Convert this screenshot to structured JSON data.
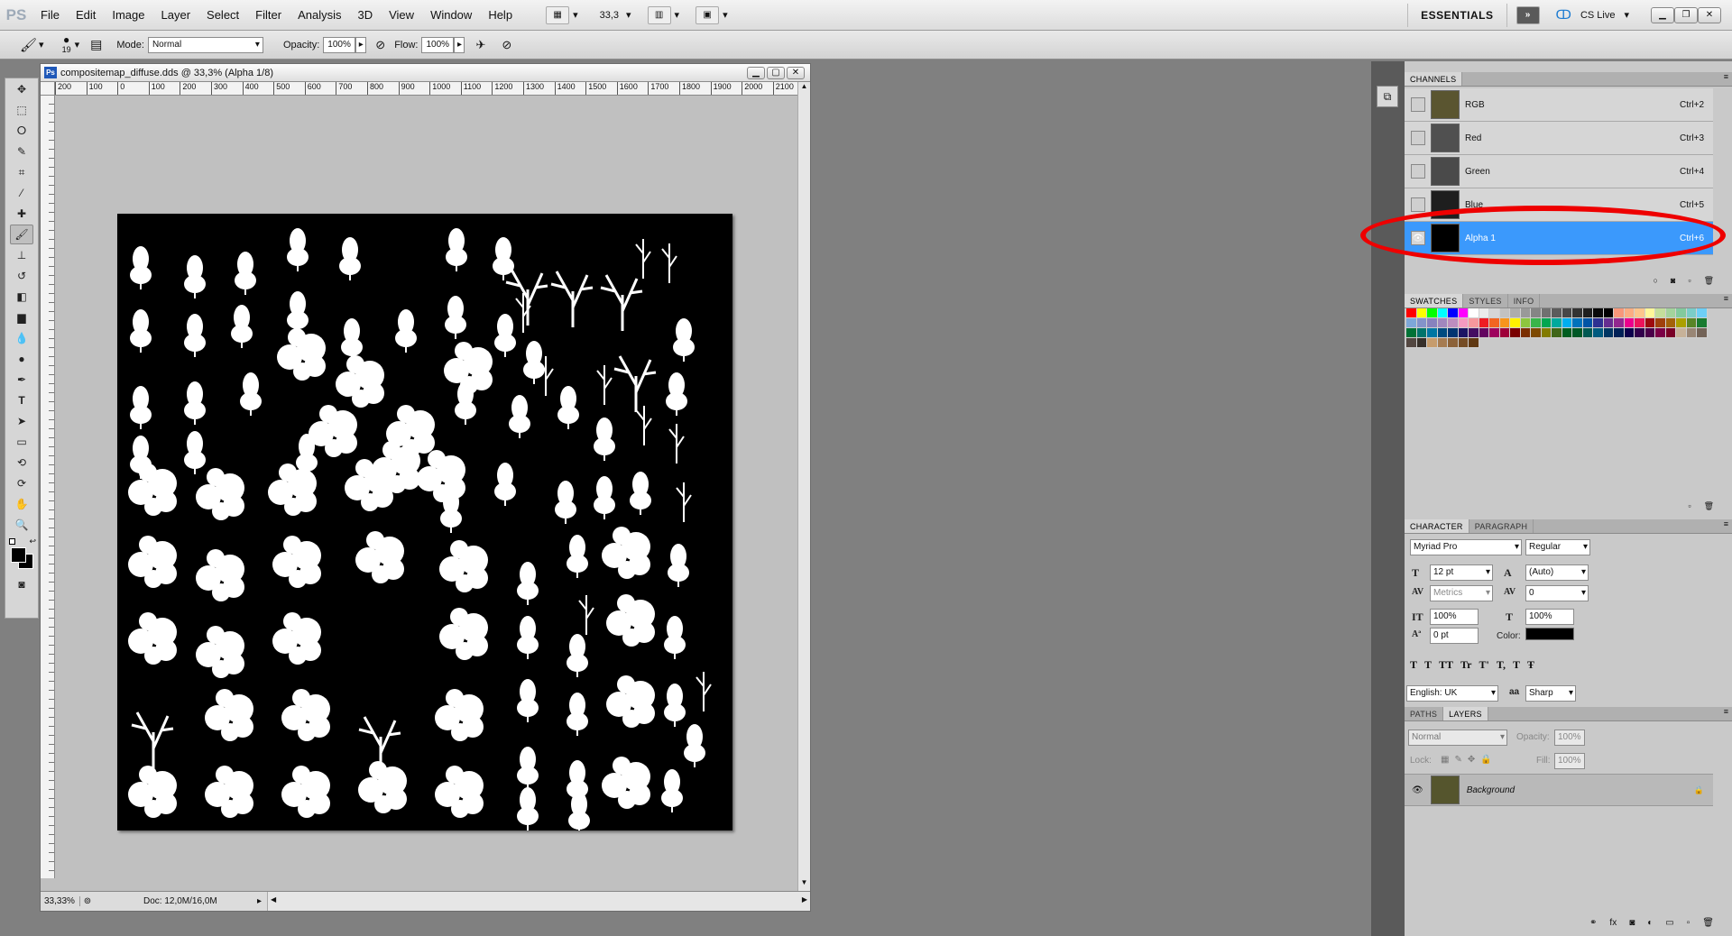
{
  "menubar": {
    "logo": "PS",
    "items": [
      "File",
      "Edit",
      "Image",
      "Layer",
      "Select",
      "Filter",
      "Analysis",
      "3D",
      "View",
      "Window",
      "Help"
    ],
    "zoom_value": "33,3",
    "workspace": "ESSENTIALS",
    "cs_live": "CS Live"
  },
  "options": {
    "brush_size": "19",
    "mode_label": "Mode:",
    "mode_value": "Normal",
    "opacity_label": "Opacity:",
    "opacity_value": "100%",
    "flow_label": "Flow:",
    "flow_value": "100%"
  },
  "document": {
    "title": "compositemap_diffuse.dds @ 33,3% (Alpha 1/8)",
    "ruler_ticks": [
      "200",
      "100",
      "0",
      "100",
      "200",
      "300",
      "400",
      "500",
      "600",
      "700",
      "800",
      "900",
      "1000",
      "1100",
      "1200",
      "1300",
      "1400",
      "1500",
      "1600",
      "1700",
      "1800",
      "1900",
      "2000",
      "2100",
      "220"
    ],
    "status_zoom": "33,33%",
    "status_doc": "Doc: 12,0M/16,0M"
  },
  "channels": {
    "tabs": [
      "CHANNELS"
    ],
    "rows": [
      {
        "name": "RGB",
        "key": "Ctrl+2",
        "thumb": "#5a5530"
      },
      {
        "name": "Red",
        "key": "Ctrl+3",
        "thumb": "#505050"
      },
      {
        "name": "Green",
        "key": "Ctrl+4",
        "thumb": "#4a4a4a"
      },
      {
        "name": "Blue",
        "key": "Ctrl+5",
        "thumb": "#1e1e1e"
      },
      {
        "name": "Alpha 1",
        "key": "Ctrl+6",
        "thumb": "#000000"
      }
    ]
  },
  "swatches": {
    "tabs": [
      "SWATCHES",
      "STYLES",
      "INFO"
    ],
    "colors": [
      "#ff0000",
      "#ffff00",
      "#00ff00",
      "#00ffff",
      "#0000ff",
      "#ff00ff",
      "#ffffff",
      "#ebebeb",
      "#d6d6d6",
      "#c2c2c2",
      "#adadad",
      "#999999",
      "#858585",
      "#707070",
      "#5c5c5c",
      "#474747",
      "#333333",
      "#1f1f1f",
      "#0a0a0a",
      "#000000",
      "#f7977a",
      "#fbad82",
      "#fdc68c",
      "#fff79a",
      "#c4df9b",
      "#a3d39c",
      "#82ca9d",
      "#7bcdc8",
      "#6ecff6",
      "#7ea7d8",
      "#8493ca",
      "#8882be",
      "#a187be",
      "#bc8dbf",
      "#f49ac1",
      "#f6989d",
      "#ed1c24",
      "#f26522",
      "#f7941d",
      "#fff200",
      "#8dc63f",
      "#39b54a",
      "#00a651",
      "#00a99d",
      "#00aeef",
      "#0072bc",
      "#0054a6",
      "#2e3192",
      "#662d91",
      "#92278f",
      "#ec008c",
      "#ed145b",
      "#9e0b0f",
      "#a0410d",
      "#a3620a",
      "#aba000",
      "#598527",
      "#197b30",
      "#007236",
      "#00746b",
      "#0076a3",
      "#004b80",
      "#003471",
      "#1b1464",
      "#440e62",
      "#630460",
      "#9e005d",
      "#9e0039",
      "#790000",
      "#7b2e00",
      "#7d4900",
      "#827b00",
      "#406618",
      "#005e20",
      "#005826",
      "#005952",
      "#005b7f",
      "#003663",
      "#002157",
      "#0d004c",
      "#32004b",
      "#4b0049",
      "#7b0046",
      "#7a0026",
      "#c7b299",
      "#998675",
      "#736357",
      "#534741",
      "#37302a",
      "#c69c6d",
      "#a67c52",
      "#8c6239",
      "#754c24",
      "#603913"
    ]
  },
  "character": {
    "tabs": [
      "CHARACTER",
      "PARAGRAPH"
    ],
    "font_family": "Myriad Pro",
    "font_style": "Regular",
    "font_size": "12 pt",
    "leading": "(Auto)",
    "kerning": "Metrics",
    "tracking": "0",
    "vscale": "100%",
    "hscale": "100%",
    "baseline": "0 pt",
    "color_label": "Color:",
    "color_value": "#000000",
    "language": "English: UK",
    "aa_label": "a",
    "antialias": "Sharp",
    "style_glyphs": [
      "T",
      "T",
      "TT",
      "Tr",
      "T'",
      "T,",
      "T",
      "Ŧ"
    ]
  },
  "layers": {
    "tabs": [
      "PATHS",
      "LAYERS"
    ],
    "blend_mode": "Normal",
    "opacity_label": "Opacity:",
    "opacity_value": "100%",
    "lock_label": "Lock:",
    "fill_label": "Fill:",
    "fill_value": "100%",
    "rows": [
      {
        "name": "Background",
        "thumb": "#55552d"
      }
    ]
  }
}
